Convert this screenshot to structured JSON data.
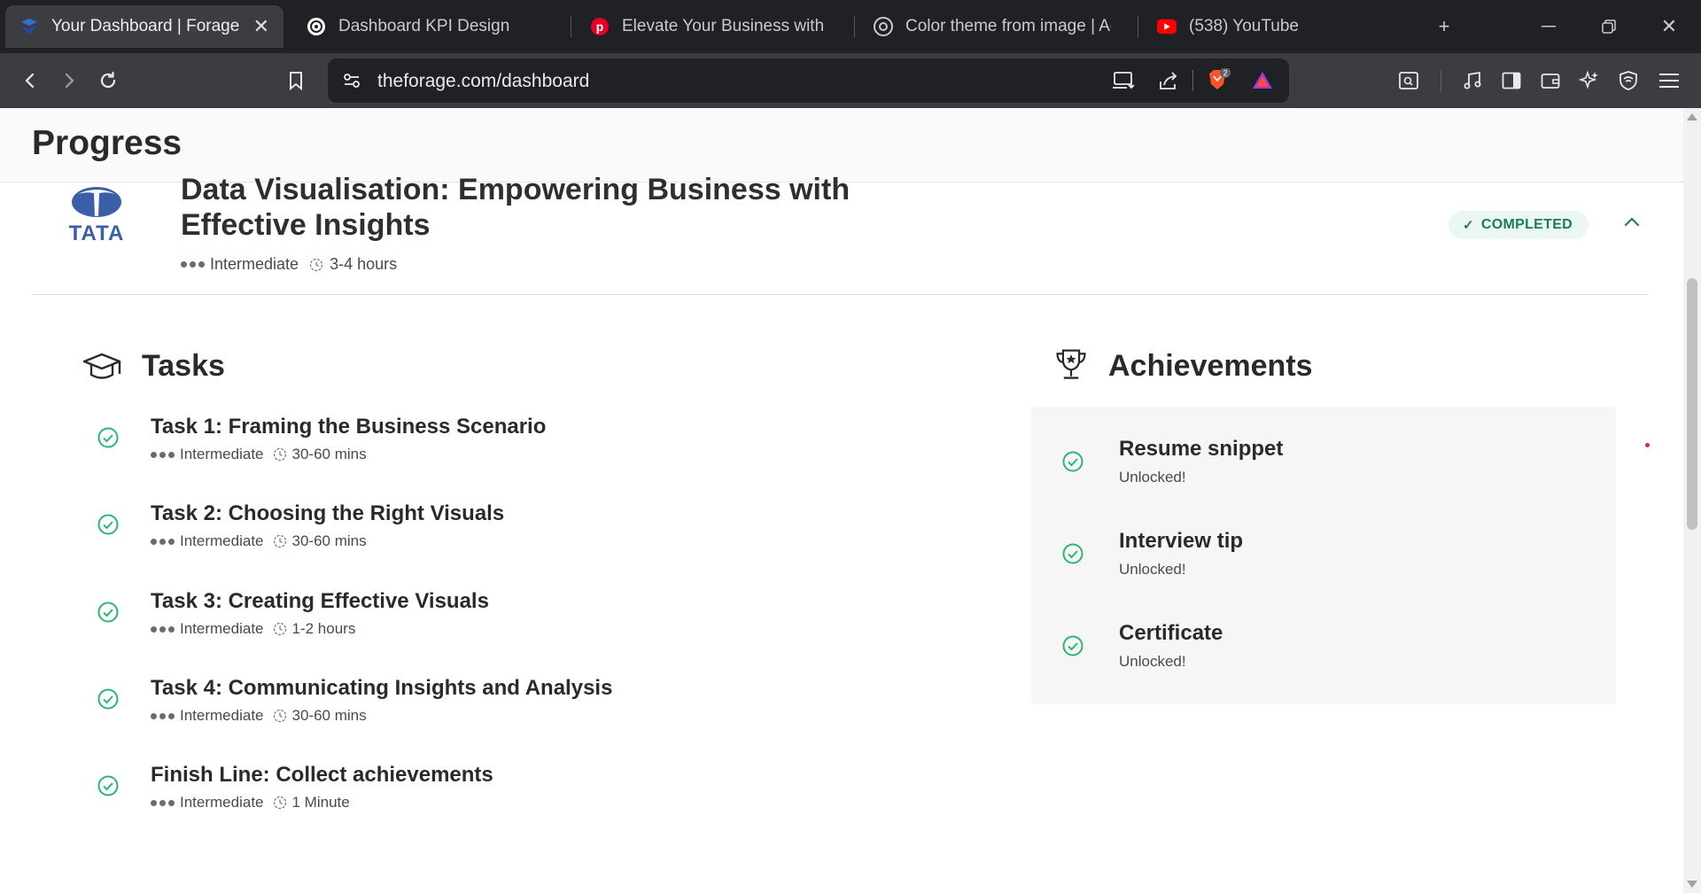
{
  "browser": {
    "tabs": [
      {
        "title": "Your Dashboard | Forage",
        "icon": "forage-icon",
        "active": true
      },
      {
        "title": "Dashboard KPI Design",
        "icon": "chatgpt-icon",
        "active": false
      },
      {
        "title": "Elevate Your Business with AIZ",
        "icon": "pinterest-icon",
        "active": false
      },
      {
        "title": "Color theme from image | Adob",
        "icon": "adobe-color-icon",
        "active": false
      },
      {
        "title": "(538) YouTube",
        "icon": "youtube-icon",
        "active": false
      }
    ],
    "url": "theforage.com/dashboard",
    "brave_badge": "2"
  },
  "page": {
    "title": "Progress",
    "course": {
      "logo_text": "TATA",
      "title": "Data Visualisation: Empowering Business with Effective Insights",
      "level": "Intermediate",
      "duration": "3-4 hours",
      "status": "COMPLETED"
    },
    "tasks_title": "Tasks",
    "tasks": [
      {
        "name": "Task 1: Framing the Business Scenario",
        "level": "Intermediate",
        "duration": "30-60 mins"
      },
      {
        "name": "Task 2: Choosing the Right Visuals",
        "level": "Intermediate",
        "duration": "30-60 mins"
      },
      {
        "name": "Task 3: Creating Effective Visuals",
        "level": "Intermediate",
        "duration": "1-2 hours"
      },
      {
        "name": "Task 4: Communicating Insights and Analysis",
        "level": "Intermediate",
        "duration": "30-60 mins"
      },
      {
        "name": "Finish Line: Collect achievements",
        "level": "Intermediate",
        "duration": "1 Minute"
      }
    ],
    "achievements_title": "Achievements",
    "achievements": [
      {
        "name": "Resume snippet",
        "status": "Unlocked!"
      },
      {
        "name": "Interview tip",
        "status": "Unlocked!"
      },
      {
        "name": "Certificate",
        "status": "Unlocked!"
      }
    ]
  },
  "colors": {
    "accent_green": "#2bb673",
    "badge_text": "#1e7a58",
    "badge_bg": "#eaf7f3",
    "tata_blue": "#3a5fa8"
  }
}
